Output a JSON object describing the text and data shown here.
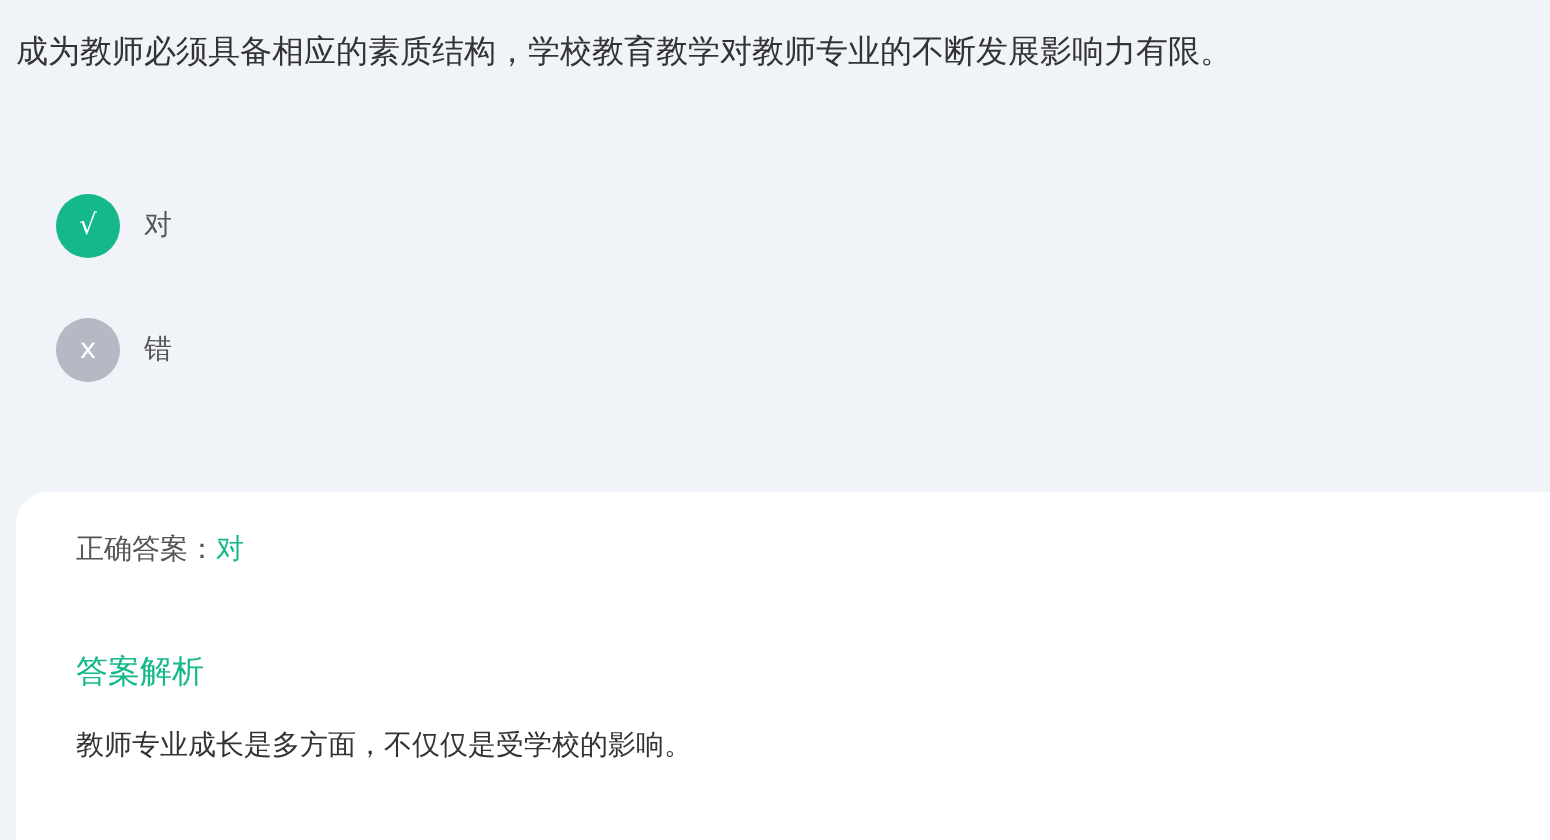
{
  "question": "成为教师必须具备相应的素质结构，学校教育教学对教师专业的不断发展影响力有限。",
  "options": [
    {
      "marker": "√",
      "label": "对",
      "selected": true
    },
    {
      "marker": "x",
      "label": "错",
      "selected": false
    }
  ],
  "answer": {
    "label": "正确答案：",
    "value": "对"
  },
  "analysis": {
    "title": "答案解析",
    "text": "教师专业成长是多方面，不仅仅是受学校的影响。"
  }
}
